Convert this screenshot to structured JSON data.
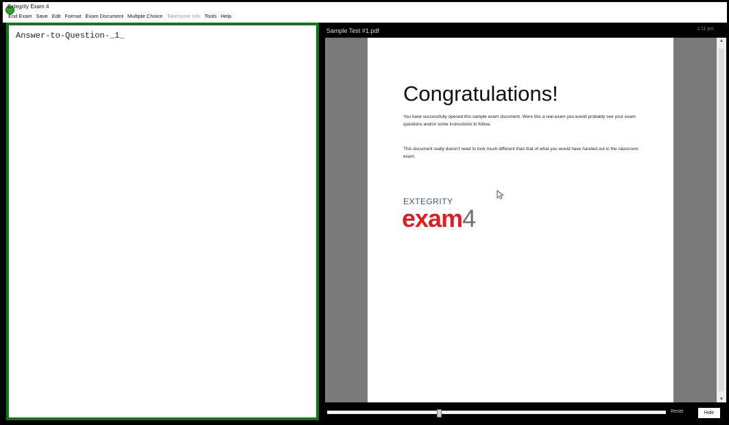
{
  "window": {
    "title": "Extegrity Exam 4"
  },
  "menu": {
    "items": [
      {
        "label": "End Exam",
        "disabled": false
      },
      {
        "label": "Save",
        "disabled": false
      },
      {
        "label": "Edit",
        "disabled": false
      },
      {
        "label": "Format",
        "disabled": false
      },
      {
        "label": "Exam Document",
        "disabled": false
      },
      {
        "label": "Multiple Choice",
        "disabled": false
      },
      {
        "label": "Takehome Info",
        "disabled": true
      },
      {
        "label": "Tools",
        "disabled": false
      },
      {
        "label": "Help",
        "disabled": false
      }
    ]
  },
  "answer_editor": {
    "content": "Answer-to-Question-_1_",
    "border_color": "#0f7a0f"
  },
  "document_viewer": {
    "file_name": "Sample Test #1.pdf",
    "clock": "1:11 pm",
    "page": {
      "heading": "Congratulations!",
      "paragraph1": "You have successfully opened this sample exam document. Were this a real exam you would probably see your exam questions and/or some instructions to follow.",
      "paragraph2": "This document really doesn't need to look much different than that of what you would have handed out in the classroom exam.",
      "logo_top": "EXTEGRITY",
      "logo_main": "exam",
      "logo_num": "4"
    },
    "zoom_slider_fraction": 0.33,
    "reset_label": "Reset",
    "hide_label": "Hide"
  },
  "colors": {
    "accent_green": "#0f7a0f",
    "brand_red": "#e11d24",
    "viewer_bg": "#7a7a7a"
  }
}
